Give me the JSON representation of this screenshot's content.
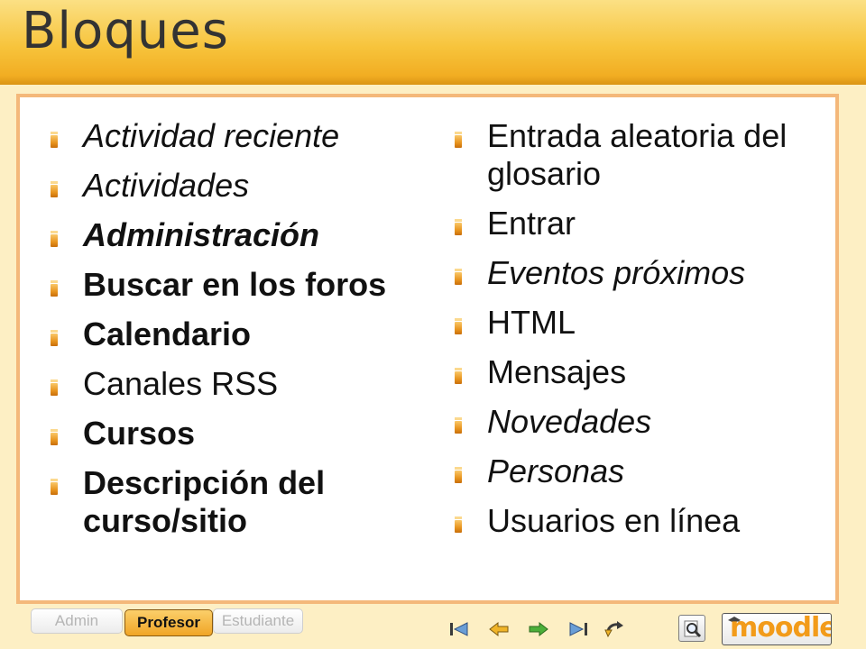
{
  "page": {
    "title": "Bloques"
  },
  "blocks": {
    "left": [
      {
        "label": "Actividad reciente",
        "style": "italic"
      },
      {
        "label": "Actividades",
        "style": "italic"
      },
      {
        "label": "Administración",
        "style": "bold italic"
      },
      {
        "label": "Buscar en los foros",
        "style": "bold"
      },
      {
        "label": "Calendario",
        "style": "bold"
      },
      {
        "label": "Canales RSS",
        "style": "normal"
      },
      {
        "label": "Cursos",
        "style": "bold"
      },
      {
        "label": "Descripción del curso/sitio",
        "style": "bold"
      }
    ],
    "right": [
      {
        "label": "Entrada aleatoria del glosario",
        "style": "normal"
      },
      {
        "label": "Entrar",
        "style": "normal"
      },
      {
        "label": "Eventos próximos",
        "style": "italic"
      },
      {
        "label": "HTML",
        "style": "normal"
      },
      {
        "label": "Mensajes",
        "style": "normal"
      },
      {
        "label": "Novedades",
        "style": "italic"
      },
      {
        "label": "Personas",
        "style": "italic"
      },
      {
        "label": "Usuarios en línea",
        "style": "normal"
      }
    ]
  },
  "role_tabs": [
    {
      "label": "Admin",
      "active": false
    },
    {
      "label": "Profesor",
      "active": true
    },
    {
      "label": "Estudiante",
      "active": false
    }
  ],
  "navigation": {
    "icons": [
      "first-slide-icon",
      "previous-slide-icon",
      "next-slide-icon",
      "last-slide-icon",
      "return-icon"
    ]
  },
  "branding": {
    "logo_text": "moodle",
    "accent_color": "#f29b1a",
    "bullet_color": "#e8941e",
    "panel_border_color": "#f4b87a"
  }
}
